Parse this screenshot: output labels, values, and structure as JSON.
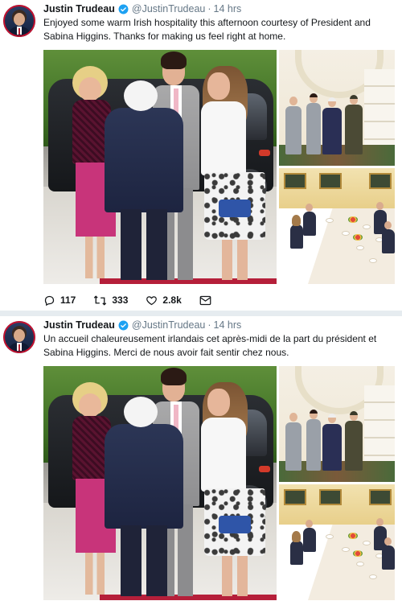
{
  "tweets": [
    {
      "author_name": "Justin Trudeau",
      "handle": "@JustinTrudeau",
      "separator": "·",
      "time": "14 hrs",
      "text": "Enjoyed some warm Irish hospitality this afternoon courtesy of President and Sabina Higgins. Thanks for making us feel right at home.",
      "actions": {
        "reply_count": "117",
        "retweet_count": "333",
        "like_count": "2.8k"
      }
    },
    {
      "author_name": "Justin Trudeau",
      "handle": "@JustinTrudeau",
      "separator": "·",
      "time": "14 hrs",
      "text": "Un accueil chaleureusement irlandais cet après-midi de la part du président et Sabina Higgins. Merci de nous avoir fait sentir chez nous."
    }
  ],
  "icons": {
    "verified": "verified-badge-icon",
    "reply": "reply-icon",
    "retweet": "retweet-icon",
    "like": "heart-icon",
    "message": "envelope-icon"
  },
  "colors": {
    "verified_blue": "#1da1f2",
    "text_primary": "#14171a",
    "text_secondary": "#657786",
    "separator": "#e6ecf0"
  }
}
